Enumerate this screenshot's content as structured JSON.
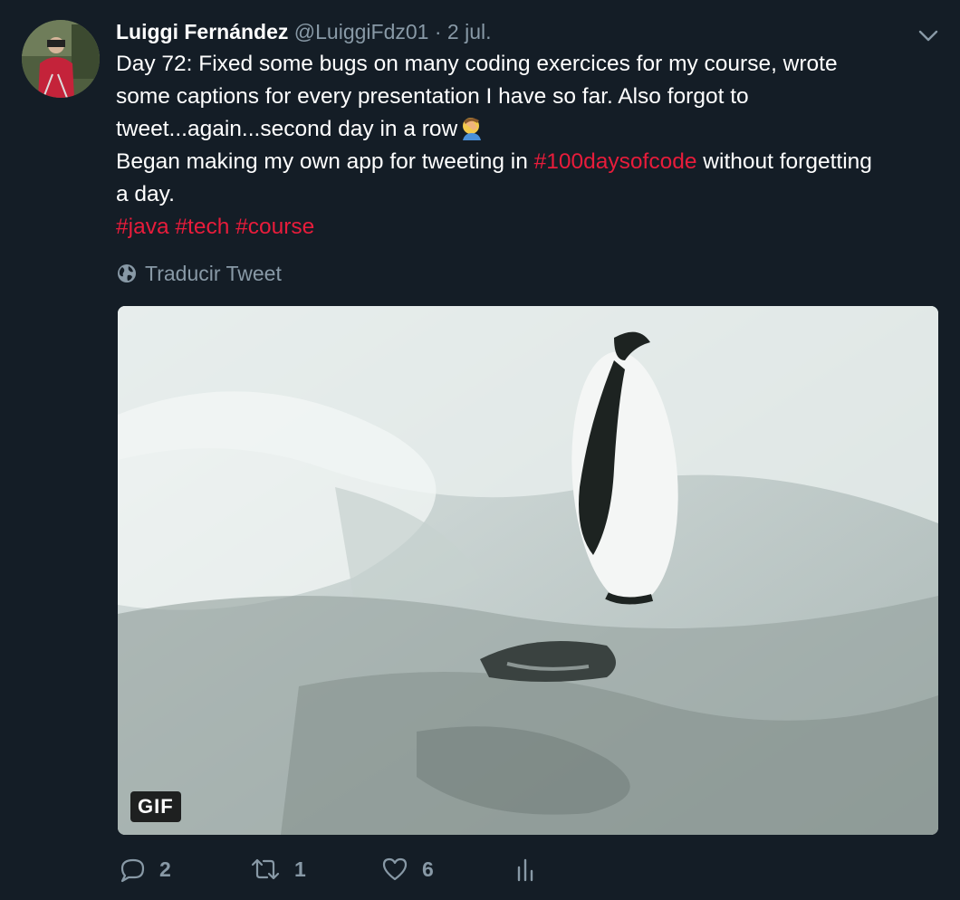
{
  "tweet": {
    "author_name": "Luiggi Fernández",
    "handle": "@LuiggiFdz01",
    "separator": "·",
    "date": "2 jul.",
    "text_lines": [
      "Day 72: Fixed some bugs on many coding exercices for my course, wrote",
      "some captions for every presentation I have so far. Also forgot to",
      "tweet...again...second day in a row"
    ],
    "line4_before": "Began making my own app for tweeting in ",
    "line4_hashtag": "#100daysofcode",
    "line4_after": " without forgetting",
    "line5": "a day.",
    "hashtags": [
      "#java",
      "#tech",
      "#course"
    ],
    "translate_label": "Traducir Tweet",
    "media_badge": "GIF",
    "counts": {
      "replies": "2",
      "retweets": "1",
      "likes": "6"
    }
  },
  "icons": {
    "caret": "chevron-down-icon",
    "translate": "globe-icon",
    "reply": "reply-icon",
    "retweet": "retweet-icon",
    "like": "heart-icon",
    "analytics": "analytics-icon",
    "emoji": "facepalm-emoji"
  },
  "colors": {
    "background": "#141d26",
    "text": "#ffffff",
    "muted": "#8899a6",
    "hashtag": "#e81c3b"
  }
}
